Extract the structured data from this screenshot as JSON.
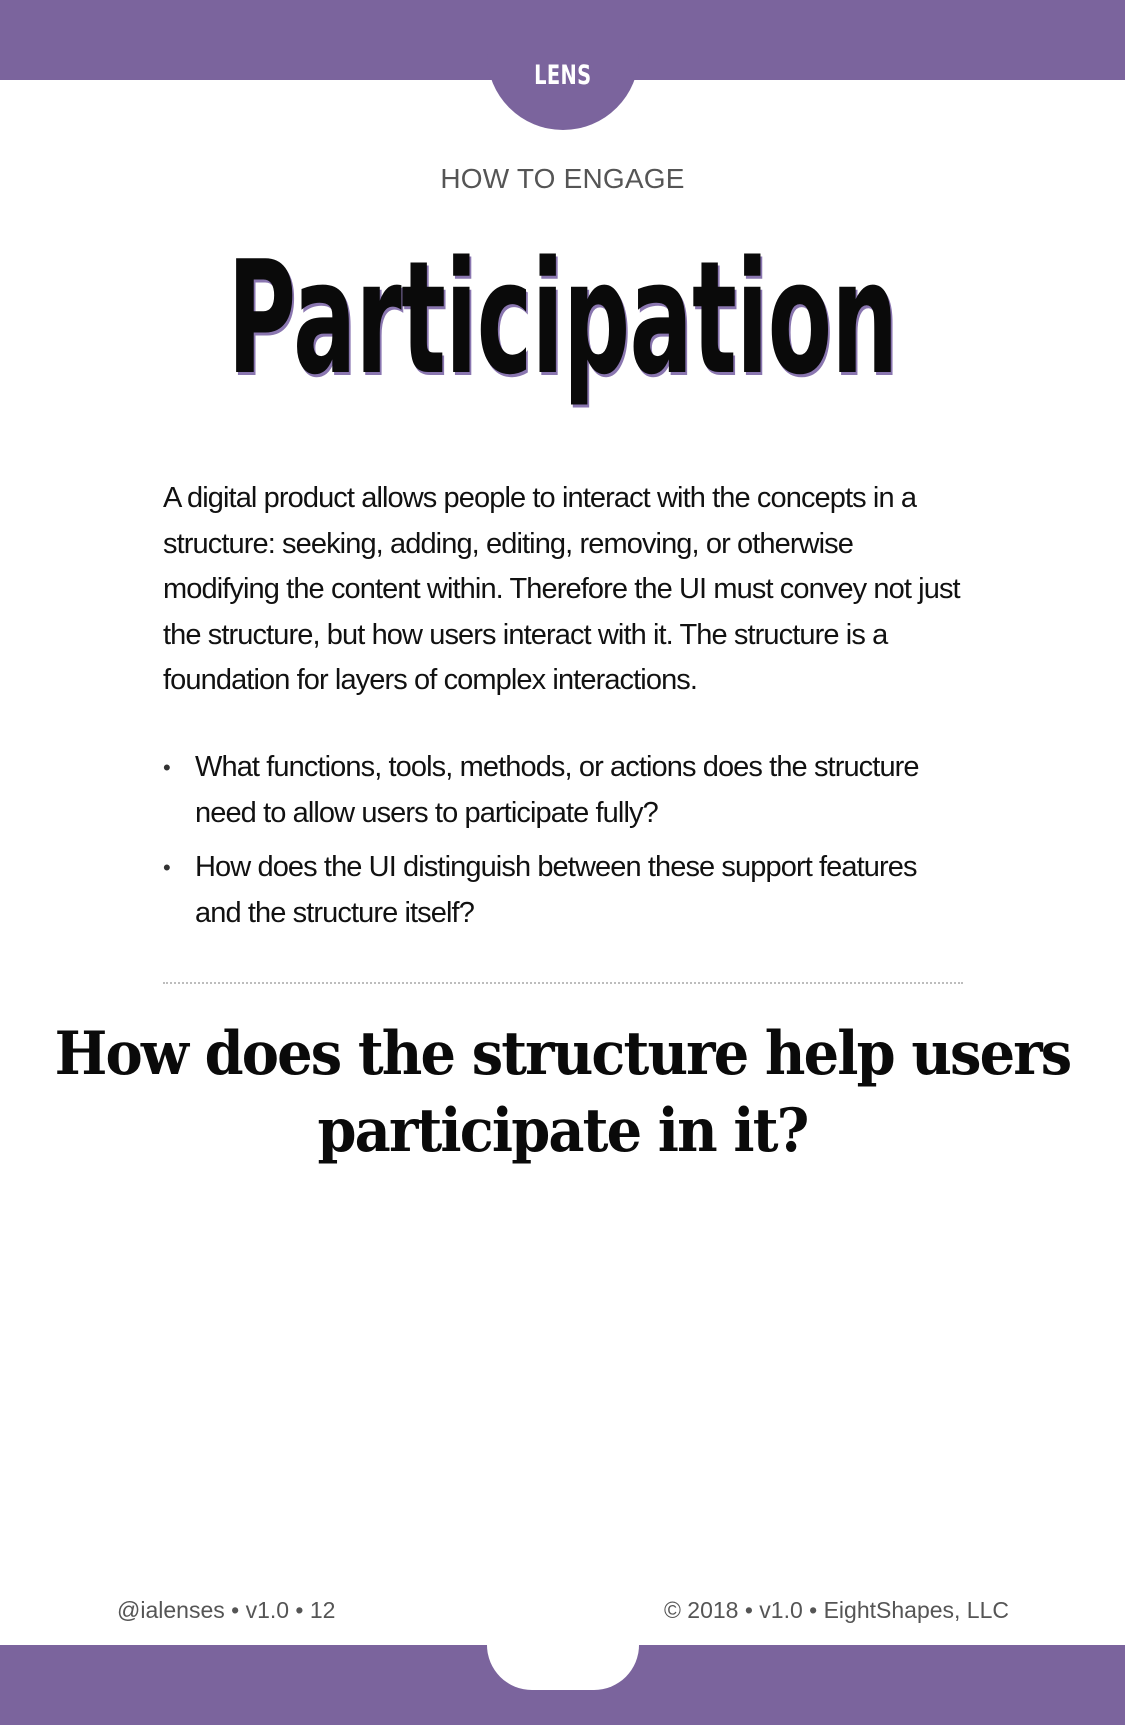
{
  "header": {
    "tab_label": "LENS",
    "kicker": "HOW TO ENGAGE",
    "title": "Participation"
  },
  "body": {
    "intro": "A digital product allows people to interact with the concepts in a structure: seeking, adding, editing, removing, or otherwise modifying the content within. Therefore the UI must convey not just the structure, but how users interact with it. The structure is a foundation for layers of complex interactions.",
    "bullet_char": "•",
    "bullets": [
      "What functions, tools, methods, or actions does the structure need to allow users to participate fully?",
      "How does the UI distinguish between these support features and the structure itself?"
    ],
    "question": "How does the structure help users participate in it?"
  },
  "footer": {
    "left": "@ialenses • v1.0 •  12",
    "right": "© 2018 • v1.0 • EightShapes, LLC"
  },
  "colors": {
    "accent": "#7b649d",
    "text": "#111111",
    "muted": "#555555"
  }
}
